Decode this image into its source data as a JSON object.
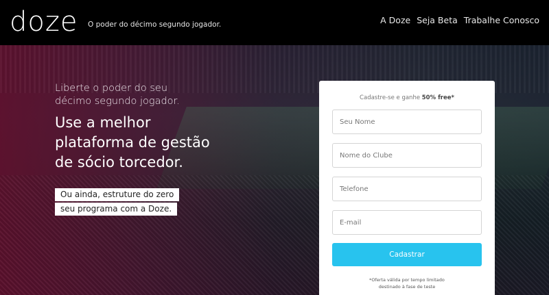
{
  "header": {
    "logo": "doze",
    "tagline": "O poder do décimo segundo jogador.",
    "nav": [
      "A Doze",
      "Seja Beta",
      "Trabalhe Conosco"
    ]
  },
  "hero": {
    "sub_line1": "Liberte o poder do seu",
    "sub_line2": "décimo segundo jogador.",
    "title_line1": "Use a melhor",
    "title_line2": "plataforma de gestão",
    "title_line3": "de sócio torcedor.",
    "highlight1": "Ou ainda, estruture do zero",
    "highlight2": "seu programa com a Doze."
  },
  "form": {
    "heading_prefix": "Cadastre-se e ganhe ",
    "heading_bold": "50% free*",
    "fields": {
      "name": "Seu Nome",
      "club": "Nome do Clube",
      "phone": "Telefone",
      "email": "E-mail"
    },
    "submit_label": "Cadastrar",
    "note_line1": "*Oferta válida por tempo limitado",
    "note_line2": "destinado à fase de teste"
  },
  "colors": {
    "accent": "#28c3ee",
    "header_bg": "#000000",
    "hero_overlay": "#5f0f2d"
  }
}
